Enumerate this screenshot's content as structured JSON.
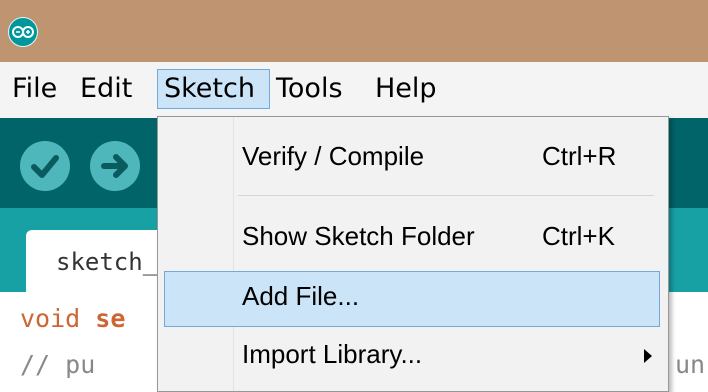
{
  "menubar": {
    "items": [
      "File",
      "Edit",
      "Sketch",
      "Tools",
      "Help"
    ],
    "active": "Sketch"
  },
  "tab": {
    "label": "sketch_"
  },
  "editor": {
    "line1_keyword": "void",
    "line1_name": "se",
    "line2": "// pu",
    "overflow_text": "un"
  },
  "sketch_menu": {
    "verify": {
      "label": "Verify / Compile",
      "shortcut": "Ctrl+R"
    },
    "show_folder": {
      "label": "Show Sketch Folder",
      "shortcut": "Ctrl+K"
    },
    "add_file": {
      "label": "Add File..."
    },
    "import_library": {
      "label": "Import Library..."
    }
  },
  "colors": {
    "titlebar": "#bf9470",
    "toolbar": "#006468",
    "tabbar": "#17a1a5",
    "highlight": "#cce4f7",
    "highlight_border": "#77a9d8"
  },
  "icons": [
    "arduino-logo-icon",
    "verify-icon",
    "upload-icon",
    "submenu-arrow-icon"
  ]
}
